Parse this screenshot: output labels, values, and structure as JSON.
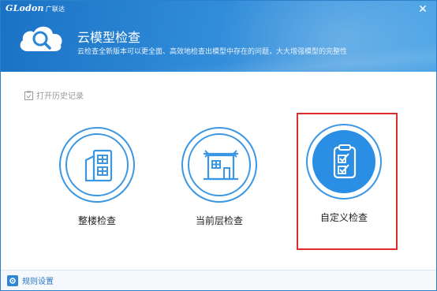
{
  "window": {
    "brand": "GLodon",
    "brand_cn": "广联达",
    "close_glyph": "✕"
  },
  "header": {
    "title": "云模型检查",
    "subtitle": "云检查全新版本可以更全面、高效地检查出模型中存在的问题，大大增强模型的完整性",
    "icon": "cloud-search-icon"
  },
  "history": {
    "label": "打开历史记录",
    "icon": "clipboard-icon"
  },
  "options": [
    {
      "label": "整楼检查",
      "icon": "building-icon"
    },
    {
      "label": "当前层检查",
      "icon": "floor-icon"
    },
    {
      "label": "自定义检查",
      "icon": "checklist-icon",
      "selected": true
    }
  ],
  "footer": {
    "settings_label": "规则设置",
    "icon": "gear-icon"
  },
  "colors": {
    "header_start": "#1a72c4",
    "header_end": "#4aa3e6",
    "accent": "#3b97e3",
    "highlight": "#e02b2b"
  }
}
